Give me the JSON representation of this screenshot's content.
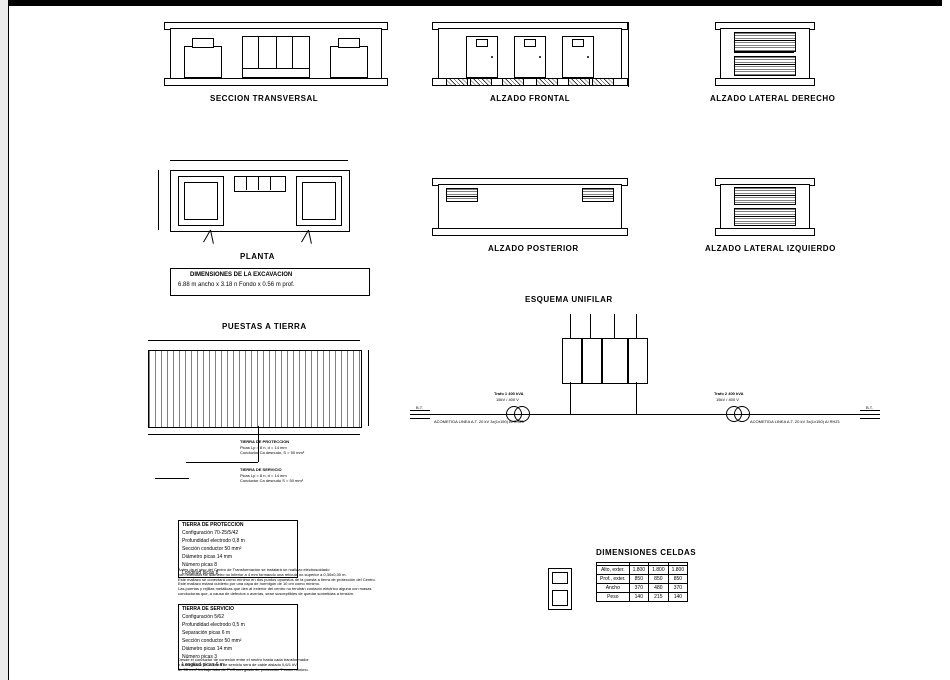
{
  "labels": {
    "seccion": "SECCION TRANSVERSAL",
    "alz_frontal": "ALZADO FRONTAL",
    "alz_lat_der": "ALZADO LATERAL DERECHO",
    "planta": "PLANTA",
    "alz_posterior": "ALZADO POSTERIOR",
    "alz_lat_izq": "ALZADO LATERAL IZQUIERDO",
    "puestas": "PUESTAS A TIERRA",
    "esquema": "ESQUEMA UNIFILAR",
    "dim_celdas": "DIMENSIONES CELDAS"
  },
  "excavacion": {
    "title": "DIMENSIONES DE LA EXCAVACION",
    "value": "6.88 m ancho x 3.18 n Fondo x 0.56 m prof."
  },
  "puestas_notes": {
    "t1_title": "TIERRA DE PROTECCION",
    "t1_l1": "Picas Lp = 8 n, d = 14 mm",
    "t1_l2": "Conductor Ca desnudo, S = 50 mm²",
    "t2_title": "TIERRA DE SERVICIO",
    "t2_l1": "Picas Lp = 8 n, d = 14 mm",
    "t2_l2": "Conductor Ca desnudo S = 50 mm²"
  },
  "notesbox1": {
    "title": "TIERRA DE PROTECCION",
    "l1": "Configuración 70-25/5/42",
    "l2": "Profundidad electrodo 0,8 m",
    "l3": "Sección conductor 50 mm²",
    "l4": "Diámetro picas 14 mm",
    "l5": "Número picas 8",
    "l6": "Longitud picas 8"
  },
  "para1": "Antes de el piso del Centro de Transformación se instalará un mallazo electrosoldado\ncon redondos de diámetro no inferior a 4 mm formando una retícula no superior a 0,30x0,30 m.\nEste mallazo se conectará como mínimo en dos puntos opuestos de la puesta a tierra de protección del Centro.\nEste mallazo estará cubierto por una capa de hormigón de 10 cm como mínimo.\nLas puertas y rejillas metálicas que den al exterior del centro no tendrán contacto eléctrico alguna con masas\nconductoras que, a causa de defectos o averías, sean susceptibles de quedar sometidas a tensión.",
  "notesbox2": {
    "title": "TIERRA DE SERVICIO",
    "l1": "Configuración 5/62",
    "l2": "Profundidad electrodo 0,5 m",
    "l3": "Separación picas 6 m",
    "l4": "Sección conductor 50 mm²",
    "l5": "Diámetro picas 14 mm",
    "l6": "Número picas 3",
    "l7": "Longitud picas 6 m"
  },
  "para2": "Desde el conductor de conexión entre el neutro hasta cada transformador\ny el electrodo de la tierra de servicio será de cable aislado 0,6/1 kV\nde 50 mm² irá bajo tubo de PVC con grado de protección 7 como mínimo.",
  "celdas": {
    "cols": [
      "",
      "",
      ""
    ],
    "rows": [
      [
        "Alto, exter.",
        "1.800",
        "1.800",
        "1.800"
      ],
      [
        "Prof., exter.",
        "850",
        "850",
        "850"
      ],
      [
        "Ancho",
        "370",
        "480",
        "370"
      ],
      [
        "Peso",
        "140",
        "215",
        "140"
      ]
    ]
  },
  "trafo": {
    "t1": "Trafo 1  400 kVA",
    "t1b": "15kV / 400 V",
    "t2": "Trafo 2  400 kVA",
    "t2b": "15kV / 400 V",
    "bt": "B.T.",
    "linea": "ACOMETIDA LINEA A.T. 20 kV  3x(1x150)  Al RHZ1"
  }
}
